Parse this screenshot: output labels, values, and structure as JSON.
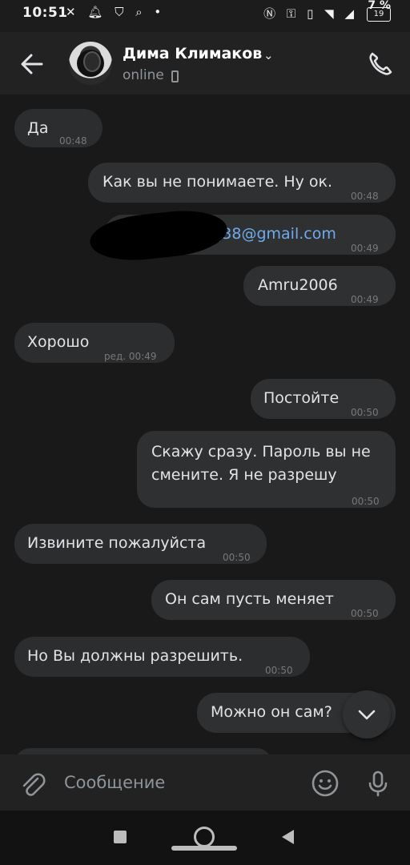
{
  "status_bar": {
    "time": "10:51",
    "battery_percent": "7 %",
    "battery_box": "19"
  },
  "header": {
    "contact_name": "Дима Климаков",
    "status": "online"
  },
  "messages": [
    {
      "id": "m1",
      "direction": "in",
      "text": "Да",
      "time": "00:48"
    },
    {
      "id": "m2",
      "direction": "out",
      "text": "Как вы не понимаете. Ну ок.",
      "time": "00:48"
    },
    {
      "id": "m3",
      "direction": "out",
      "text": "j38@gmail.com",
      "time": "00:49",
      "is_link": true,
      "redacted_prefix": true
    },
    {
      "id": "m4",
      "direction": "out",
      "text": "Amru2006",
      "time": "00:49"
    },
    {
      "id": "m5",
      "direction": "in",
      "text": "Хорошо",
      "time": "ред. 00:49"
    },
    {
      "id": "m6",
      "direction": "out",
      "text": "Постойте",
      "time": "00:50"
    },
    {
      "id": "m7",
      "direction": "out",
      "lines": [
        "Скажу сразу. Пароль вы не",
        "смените. Я не разрешу"
      ],
      "time": "00:50"
    },
    {
      "id": "m8",
      "direction": "in",
      "text": "Извините пожалуйста",
      "time": "00:50"
    },
    {
      "id": "m9",
      "direction": "out",
      "text": "Он сам пусть меняет",
      "time": "00:50"
    },
    {
      "id": "m10",
      "direction": "in",
      "text": "Но Вы должны разрешить.",
      "time": "00:50"
    },
    {
      "id": "m11",
      "direction": "out",
      "text": "Можно он сам?",
      "time": ""
    }
  ],
  "composer": {
    "placeholder": "Сообщение"
  },
  "icons": {
    "back": "arrow-left-icon",
    "call": "phone-icon",
    "attach": "paperclip-icon",
    "emoji": "smile-icon",
    "mic": "microphone-icon",
    "scroll_down": "chevron-down-icon"
  },
  "colors": {
    "background": "#19191a",
    "bubble": "#2c2d2e",
    "link": "#71aaeb",
    "secondary_text": "#8f9499"
  }
}
